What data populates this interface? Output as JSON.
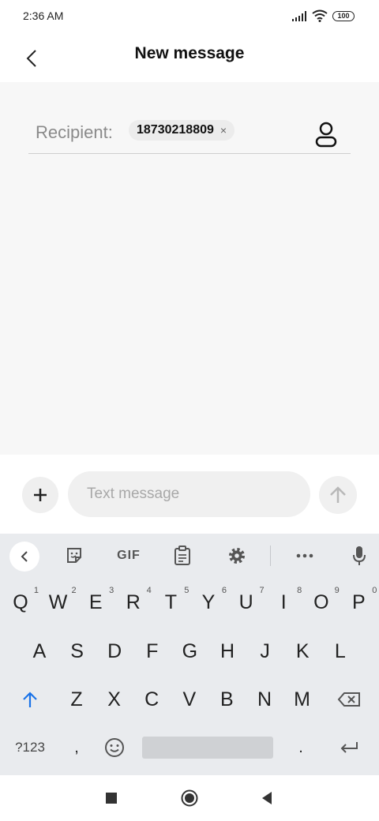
{
  "status_bar": {
    "time": "2:36 AM",
    "battery": "100"
  },
  "header": {
    "title": "New message"
  },
  "recipient": {
    "label": "Recipient:",
    "number": "18730218809",
    "remove_symbol": "×"
  },
  "compose": {
    "placeholder": "Text message"
  },
  "keyboard": {
    "toolbar": [
      "collapse-icon",
      "sticker-icon",
      "gif-icon",
      "clipboard-icon",
      "settings-icon",
      "more-icon",
      "mic-icon"
    ],
    "gif_label": "GIF",
    "row1": [
      {
        "label": "Q",
        "hint": "1"
      },
      {
        "label": "W",
        "hint": "2"
      },
      {
        "label": "E",
        "hint": "3"
      },
      {
        "label": "R",
        "hint": "4"
      },
      {
        "label": "T",
        "hint": "5"
      },
      {
        "label": "Y",
        "hint": "6"
      },
      {
        "label": "U",
        "hint": "7"
      },
      {
        "label": "I",
        "hint": "8"
      },
      {
        "label": "O",
        "hint": "9"
      },
      {
        "label": "P",
        "hint": "0"
      }
    ],
    "row2": [
      "A",
      "S",
      "D",
      "F",
      "G",
      "H",
      "J",
      "K",
      "L"
    ],
    "row3": [
      "Z",
      "X",
      "C",
      "V",
      "B",
      "N",
      "M"
    ],
    "symbols_label": "?123",
    "comma_label": ",",
    "period_label": ".",
    "accent_color": "#1a73e8"
  },
  "nav_bar": [
    "recents-square-icon",
    "home-circle-icon",
    "back-triangle-icon"
  ]
}
